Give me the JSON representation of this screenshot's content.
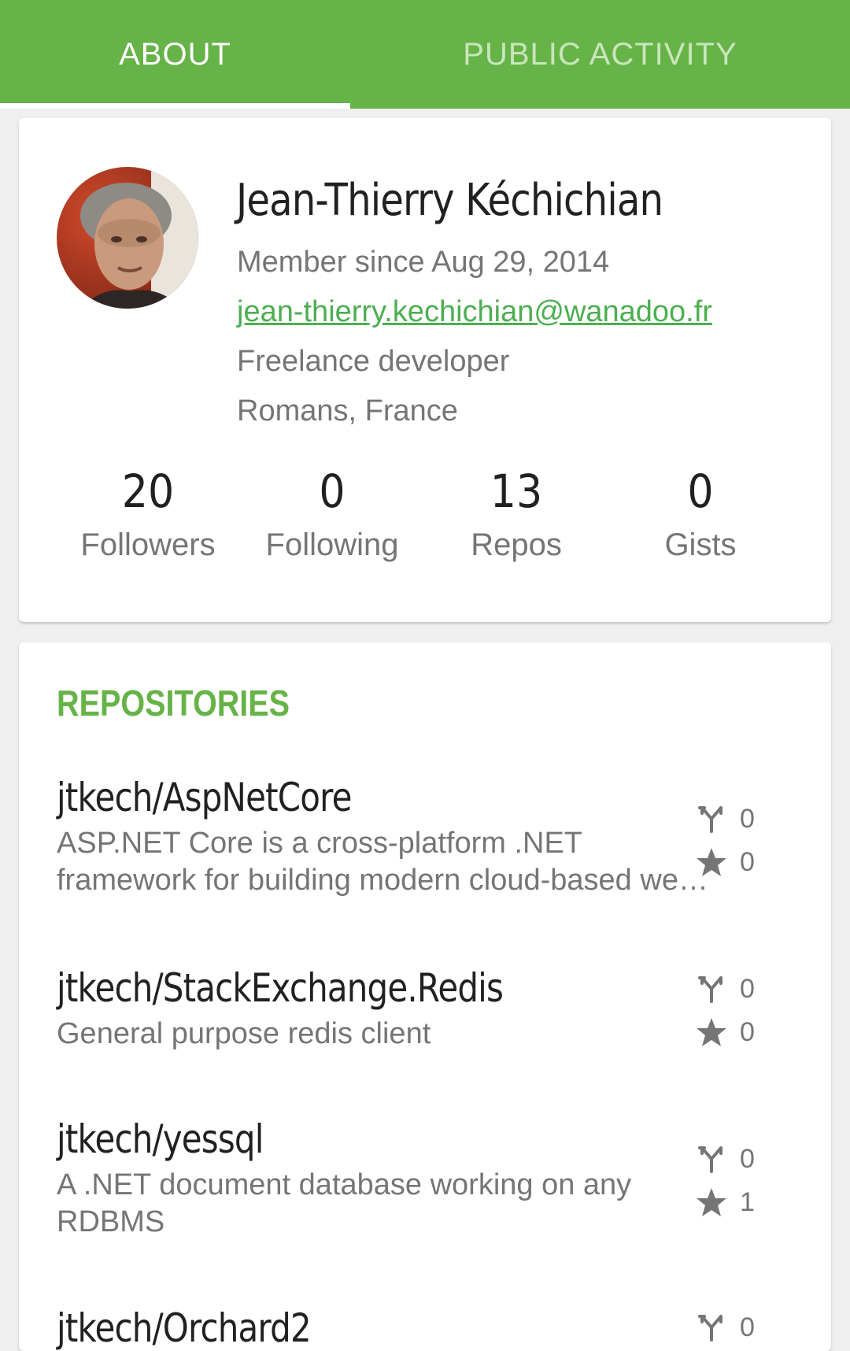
{
  "tabs": [
    {
      "label": "ABOUT",
      "selected": true
    },
    {
      "label": "PUBLIC ACTIVITY",
      "selected": false
    }
  ],
  "colors": {
    "accent": "#66b348",
    "link": "#4caf50"
  },
  "profile": {
    "name": "Jean-Thierry Kéchichian",
    "member_since": "Member since Aug 29, 2014",
    "email": "jean-thierry.kechichian@wanadoo.fr",
    "bio": "Freelance developer",
    "location": "Romans, France",
    "stats": [
      {
        "value": "20",
        "label": "Followers"
      },
      {
        "value": "0",
        "label": "Following"
      },
      {
        "value": "13",
        "label": "Repos"
      },
      {
        "value": "0",
        "label": "Gists"
      }
    ]
  },
  "repositories": {
    "title": "REPOSITORIES",
    "items": [
      {
        "name": "jtkech/AspNetCore",
        "description": "ASP.NET Core is a cross-platform .NET framework for building modern cloud-based web applications",
        "forks": "0",
        "stars": "0"
      },
      {
        "name": "jtkech/StackExchange.Redis",
        "description": "General purpose redis client",
        "forks": "0",
        "stars": "0"
      },
      {
        "name": "jtkech/yessql",
        "description": "A .NET document database working on any RDBMS",
        "forks": "0",
        "stars": "1"
      },
      {
        "name": "jtkech/Orchard2",
        "description": "",
        "forks": "0",
        "stars": ""
      }
    ]
  }
}
